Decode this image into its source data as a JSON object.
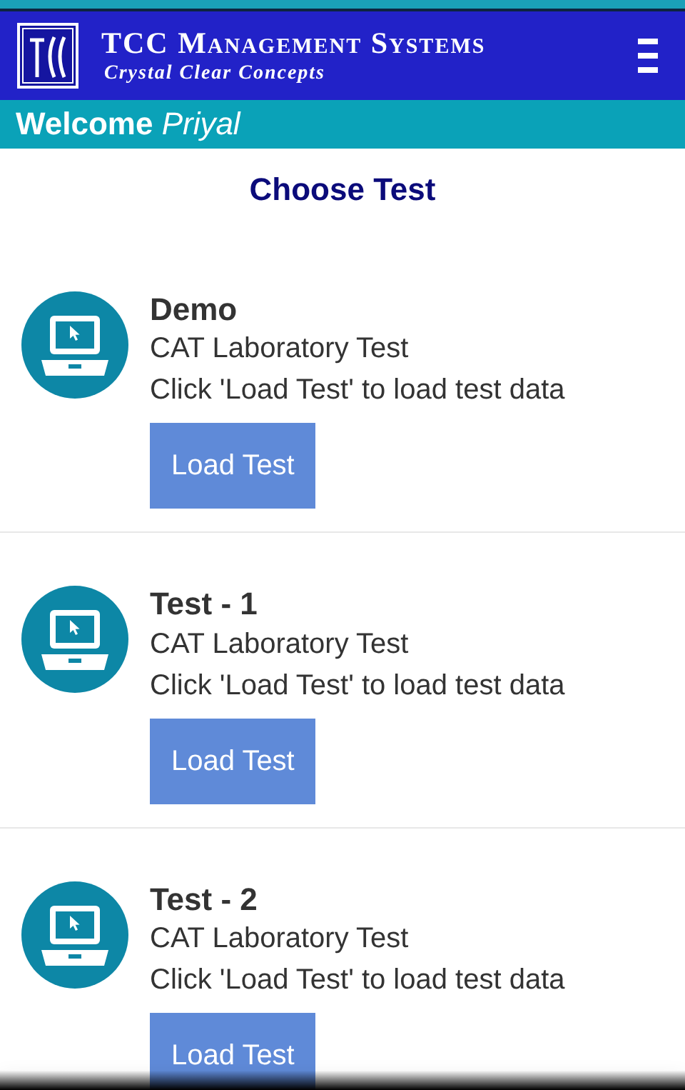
{
  "header": {
    "brand": "TCC Management Systems",
    "tagline": "Crystal Clear Concepts"
  },
  "welcome": "Welcome *Priyal*",
  "heading": "Choose Test",
  "tests": [
    {
      "title": "Demo",
      "subtitle": "CAT Laboratory Test",
      "hint": "Click 'Load Test' to load test data",
      "button": "Load Test"
    },
    {
      "title": "Test - 1",
      "subtitle": "CAT Laboratory Test",
      "hint": "Click 'Load Test' to load test data",
      "button": "Load Test"
    },
    {
      "title": "Test - 2",
      "subtitle": "CAT Laboratory Test",
      "hint": "Click 'Load Test' to load test data",
      "button": "Load Test"
    }
  ]
}
